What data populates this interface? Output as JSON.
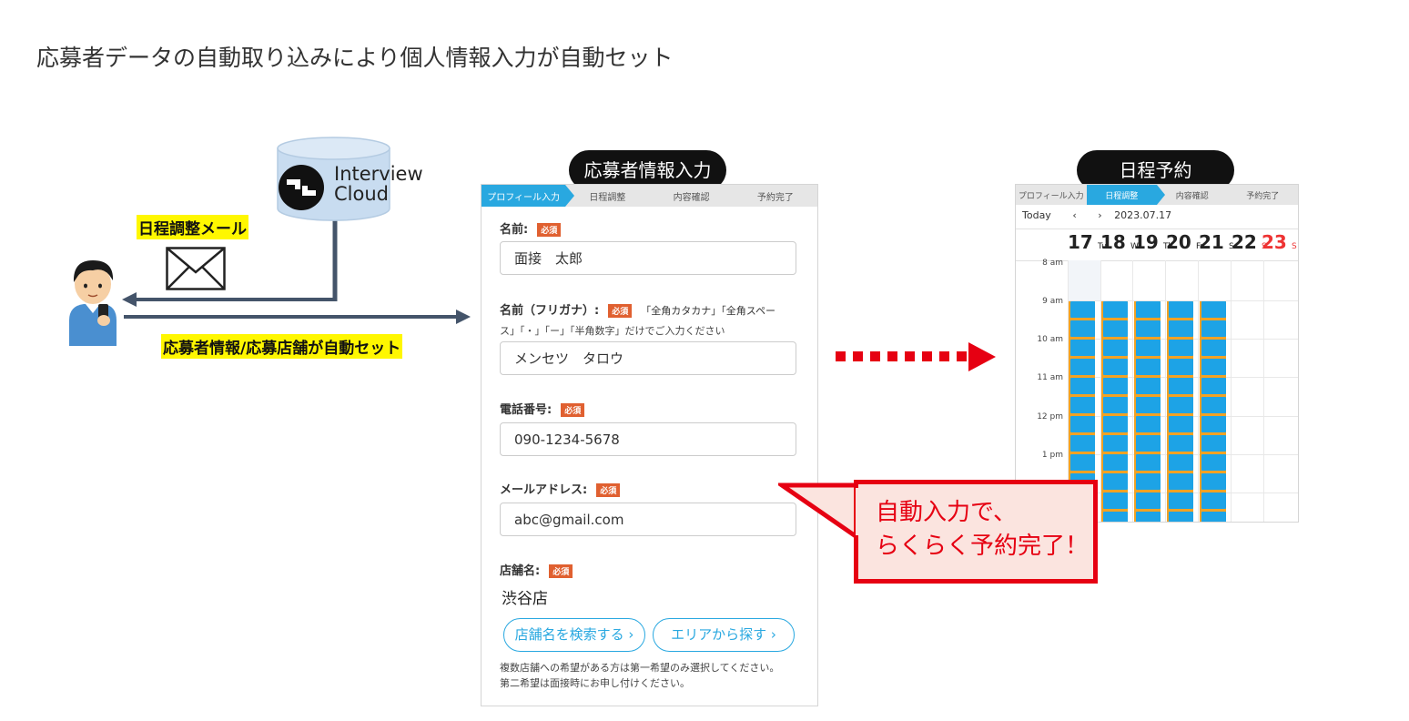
{
  "title": "応募者データの自動取り込みにより個人情報入力が自動セット",
  "database": {
    "line1": "Interview",
    "line2": "Cloud"
  },
  "labels": {
    "mail": "日程調整メール",
    "auto_set": "応募者情報/応募店舗が自動セット"
  },
  "pills": {
    "form": "応募者情報入力",
    "calendar": "日程予約"
  },
  "steps": [
    "プロフィール入力",
    "日程調整",
    "内容確認",
    "予約完了"
  ],
  "form": {
    "required_badge": "必須",
    "name_label": "名前:",
    "name_value": "面接　太郎",
    "kana_label": "名前（フリガナ）:",
    "kana_note1": "「全角カタカナ」「全角スペー",
    "kana_note2": "ス」「・」「ー」「半角数字」だけでご入力ください",
    "kana_value": "メンセツ　タロウ",
    "phone_label": "電話番号:",
    "phone_value": "090-1234-5678",
    "email_label": "メールアドレス:",
    "email_value": "abc@gmail.com",
    "store_label": "店舗名:",
    "store_value": "渋谷店",
    "search_button": "店舗名を検索する ›",
    "area_button": "エリアから探す ›",
    "store_note1": "複数店舗への希望がある方は第一希望のみ選択してください。",
    "store_note2": "第二希望は面接時にお申し付けください。"
  },
  "calendar": {
    "today": "Today",
    "prev": "‹",
    "next": "›",
    "date": "2023.07.17",
    "days": [
      {
        "num": "17",
        "dow": "M"
      },
      {
        "num": "18",
        "dow": "Tu"
      },
      {
        "num": "19",
        "dow": "W"
      },
      {
        "num": "20",
        "dow": "Th"
      },
      {
        "num": "21",
        "dow": "Fr"
      },
      {
        "num": "22",
        "dow": "S"
      },
      {
        "num": "23",
        "dow": "S"
      }
    ],
    "hours": [
      "8 am",
      "9 am",
      "10 am",
      "11 am",
      "12 pm",
      "1 pm"
    ]
  },
  "callout": {
    "line1": "自動入力で、",
    "line2": "らくらく予約完了！"
  },
  "colors": {
    "accent_blue": "#29a8e0",
    "slot_blue": "#1da3e6",
    "red": "#e60012",
    "highlight": "#fff700"
  }
}
